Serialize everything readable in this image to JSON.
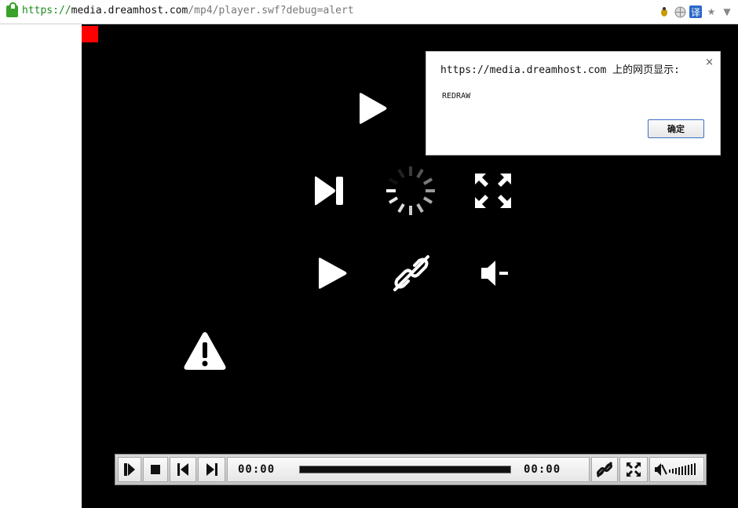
{
  "browser": {
    "url_scheme": "https://",
    "url_host": "media.dreamhost.com",
    "url_path": "/mp4/player.swf?debug=alert",
    "icons": [
      "bug-icon",
      "globe-icon",
      "translate-icon",
      "star-icon",
      "dropdown-icon"
    ],
    "translate_glyph": "译"
  },
  "dialog": {
    "title": "https://media.dreamhost.com 上的网页显示:",
    "message": "REDRAW",
    "ok_label": "确定",
    "close_glyph": "×"
  },
  "controlbar": {
    "elapsed": "00:00",
    "duration": "00:00"
  },
  "colors": {
    "player_bg": "#000000",
    "marker": "#ff0000",
    "lock": "#3aa12a"
  }
}
